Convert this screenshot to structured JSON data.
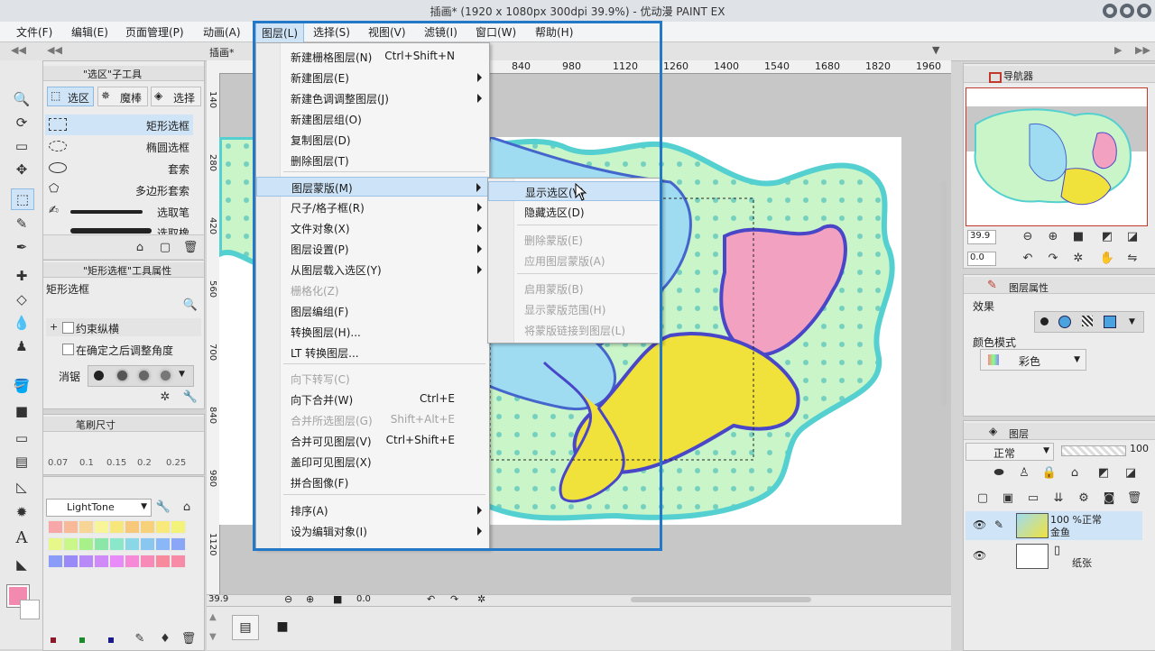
{
  "window": {
    "title": "插画* (1920 x 1080px 300dpi 39.9%)  - 优动漫 PAINT EX"
  },
  "menubar": [
    "文件(F)",
    "编辑(E)",
    "页面管理(P)",
    "动画(A)",
    "图层(L)",
    "选择(S)",
    "视图(V)",
    "滤镜(I)",
    "窗口(W)",
    "帮助(H)"
  ],
  "canvas_tab": "插画*",
  "ruler_top": [
    "840",
    "980",
    "1120",
    "1260",
    "1400",
    "1540",
    "1680",
    "1820",
    "1960"
  ],
  "ruler_left": [
    "140",
    "280",
    "420",
    "560",
    "700",
    "840",
    "980",
    "1120"
  ],
  "subtool": {
    "header": "\"选区\"子工具",
    "tabs": [
      "选区",
      "魔棒",
      "选择"
    ],
    "items": [
      "矩形选框",
      "椭圆选框",
      "套索",
      "多边形套索",
      "选取笔",
      "选取橡"
    ]
  },
  "toolprop": {
    "header": "\"矩形选框\"工具属性",
    "name": "矩形选框",
    "opt1": "约束纵横",
    "opt2": "在确定之后调整角度",
    "opt3": "消锯"
  },
  "brushsize": {
    "header": "笔刷尺寸",
    "values": [
      "0.07",
      "0.1",
      "0.15",
      "0.2",
      "0.25"
    ]
  },
  "palette": {
    "name": "LightTone"
  },
  "layer_menu": {
    "items": [
      {
        "label": "新建栅格图层(N)",
        "shortcut": "Ctrl+Shift+N"
      },
      {
        "label": "新建图层(E)",
        "arrow": true
      },
      {
        "label": "新建色调调整图层(J)",
        "arrow": true
      },
      {
        "label": "新建图层组(O)"
      },
      {
        "label": "复制图层(D)"
      },
      {
        "label": "删除图层(T)"
      },
      {
        "label": "图层蒙版(M)",
        "arrow": true,
        "highlight": true
      },
      {
        "label": "尺子/格子框(R)",
        "arrow": true
      },
      {
        "label": "文件对象(X)",
        "arrow": true
      },
      {
        "label": "图层设置(P)",
        "arrow": true
      },
      {
        "label": "从图层载入选区(Y)",
        "arrow": true
      },
      {
        "label": "栅格化(Z)",
        "disabled": true
      },
      {
        "label": "图层编组(F)"
      },
      {
        "label": "转换图层(H)..."
      },
      {
        "label": "LT 转换图层..."
      },
      {
        "label": "向下转写(C)",
        "disabled": true
      },
      {
        "label": "向下合并(W)",
        "shortcut": "Ctrl+E"
      },
      {
        "label": "合并所选图层(G)",
        "shortcut": "Shift+Alt+E",
        "disabled": true
      },
      {
        "label": "合并可见图层(V)",
        "shortcut": "Ctrl+Shift+E"
      },
      {
        "label": "盖印可见图层(X)"
      },
      {
        "label": "拼合图像(F)"
      },
      {
        "label": "排序(A)",
        "arrow": true
      },
      {
        "label": "设为编辑对象(I)",
        "arrow": true
      }
    ]
  },
  "mask_submenu": {
    "items": [
      {
        "label": "显示选区(V)",
        "highlight": true
      },
      {
        "label": "隐藏选区(D)"
      },
      {
        "label": "删除蒙版(E)",
        "disabled": true
      },
      {
        "label": "应用图层蒙版(A)",
        "disabled": true
      },
      {
        "label": "启用蒙版(B)",
        "disabled": true
      },
      {
        "label": "显示蒙版范围(H)",
        "disabled": true
      },
      {
        "label": "将蒙版链接到图层(L)",
        "disabled": true
      }
    ]
  },
  "navigator": {
    "tab": "导航器",
    "zoom": "39.9",
    "angle": "0.0"
  },
  "layer_props": {
    "tab": "图层属性",
    "effect_label": "效果",
    "color_mode_label": "颜色模式",
    "color_mode_value": "彩色"
  },
  "layers": {
    "tab": "图层",
    "blend": "正常",
    "opacity": "100",
    "items": [
      {
        "info": "100 %正常",
        "name": "金鱼"
      },
      {
        "info": "",
        "name": "纸张"
      }
    ]
  },
  "canvas_status": {
    "zoom": "39.9",
    "angle": "0.0"
  }
}
